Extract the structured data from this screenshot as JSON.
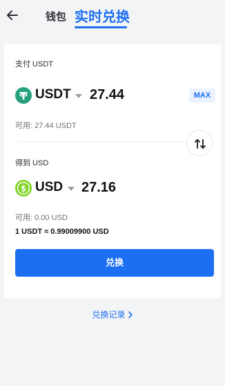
{
  "header": {
    "tabs": [
      {
        "label": "钱包",
        "active": false
      },
      {
        "label": "实时兑换",
        "active": true
      }
    ]
  },
  "pay": {
    "label": "支付 USDT",
    "coin": "USDT",
    "coin_icon": "tether-icon",
    "amount": "27.44",
    "max_label": "MAX",
    "available": "可用: 27.44 USDT"
  },
  "receive": {
    "label": "得到 USD",
    "coin": "USD",
    "coin_icon": "dollar-coin-icon",
    "amount": "27.16",
    "available": "可用: 0.00 USD"
  },
  "rate": "1 USDT ≈ 0.99009900 USD",
  "submit_label": "兑换",
  "history_link": "兑换记录",
  "colors": {
    "accent": "#1d6ff2",
    "tether": "#26a17b",
    "usd_coin": "#7ed321",
    "background": "#f3f4f6"
  }
}
